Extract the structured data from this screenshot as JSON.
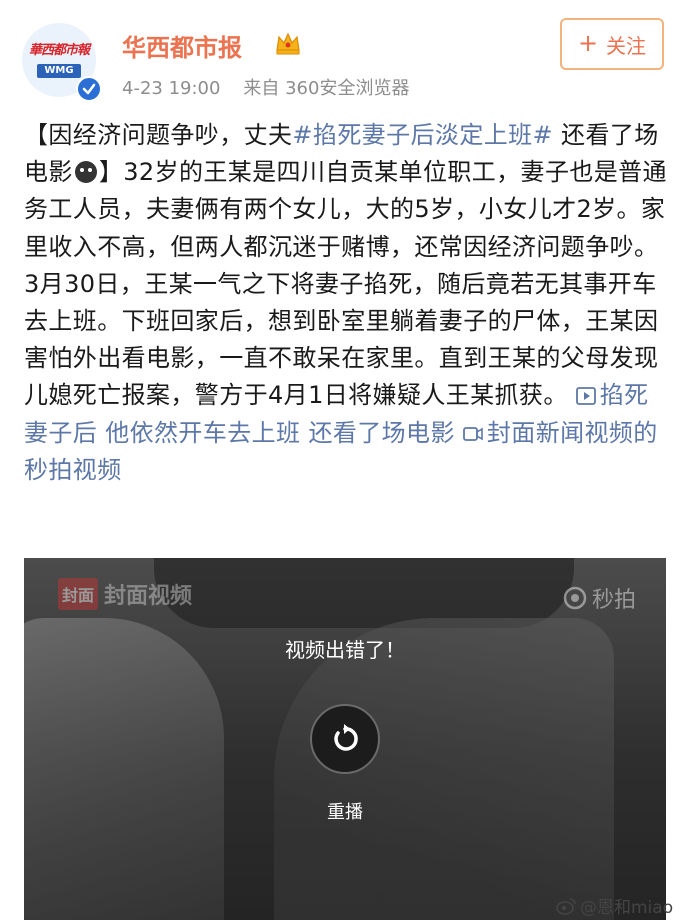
{
  "account": {
    "avatar_text": "華西都市報",
    "avatar_badge": "WMG",
    "name": "华西都市报",
    "timestamp": "4-23 19:00",
    "source": "来自 360安全浏览器"
  },
  "follow_button": {
    "label": "关注",
    "plus": "+"
  },
  "post": {
    "part1": "【因经济问题争吵，丈夫",
    "hashtag": "#掐死妻子后淡定上班#",
    "part2": " 还看了场电影",
    "part3": "】32岁的王某是四川自贡某单位职工，妻子也是普通务工人员，夫妻俩有两个女儿，大的5岁，小女儿才2岁。家里收入不高，但两人都沉迷于赌博，还常因经济问题争吵。3月30日，王某一气之下将妻子掐死，随后竟若无其事开车去上班。下班回家后，想到卧室里躺着妻子的尸体，王某因害怕外出看电影，一直不敢呆在家里。直到王某的父母发现儿媳死亡报案，警方于4月1日将嫌疑人王某抓获。",
    "video_link": "掐死妻子后 他依然开车去上班 还看了场电影",
    "channel_link": "封面新闻视频的秒拍视频"
  },
  "video": {
    "watermark_left_badge": "封面",
    "watermark_left_brand": "封面视频",
    "watermark_right_brand": "秒拍",
    "error_message": "视频出错了！",
    "replay_label": "重播"
  },
  "source_watermark": "@恩和miao",
  "colors": {
    "accent": "#eb7350",
    "link": "#5d78a8",
    "verified": "#2b6fd6"
  }
}
